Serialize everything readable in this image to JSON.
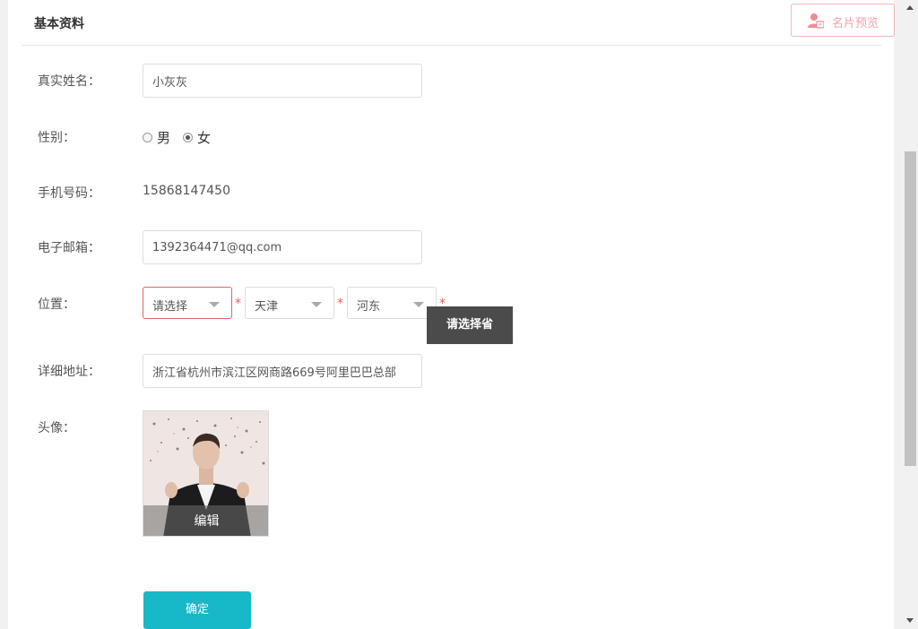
{
  "header": {
    "title": "基本资料",
    "preview_button": "名片预览",
    "preview_icon": "user-card-icon"
  },
  "form": {
    "name": {
      "label": "真实姓名：",
      "value": "小灰灰"
    },
    "gender": {
      "label": "性别：",
      "options": [
        "男",
        "女"
      ],
      "selected": "女"
    },
    "phone": {
      "label": "手机号码：",
      "value": "15868147450"
    },
    "email": {
      "label": "电子邮箱：",
      "value": "1392364471@qq.com"
    },
    "location": {
      "label": "位置：",
      "province": "请选择",
      "city": "天津",
      "district": "河东",
      "required_mark": "*",
      "tooltip": "请选择省"
    },
    "address": {
      "label": "详细地址：",
      "value": "浙江省杭州市滨江区网商路669号阿里巴巴总部"
    },
    "avatar": {
      "label": "头像：",
      "edit_label": "编辑"
    },
    "submit_label": "确定"
  },
  "colors": {
    "accent": "#17b8c8",
    "error": "#e36363",
    "preview_border": "#f4b5bd",
    "preview_text": "#f4a1ab"
  }
}
